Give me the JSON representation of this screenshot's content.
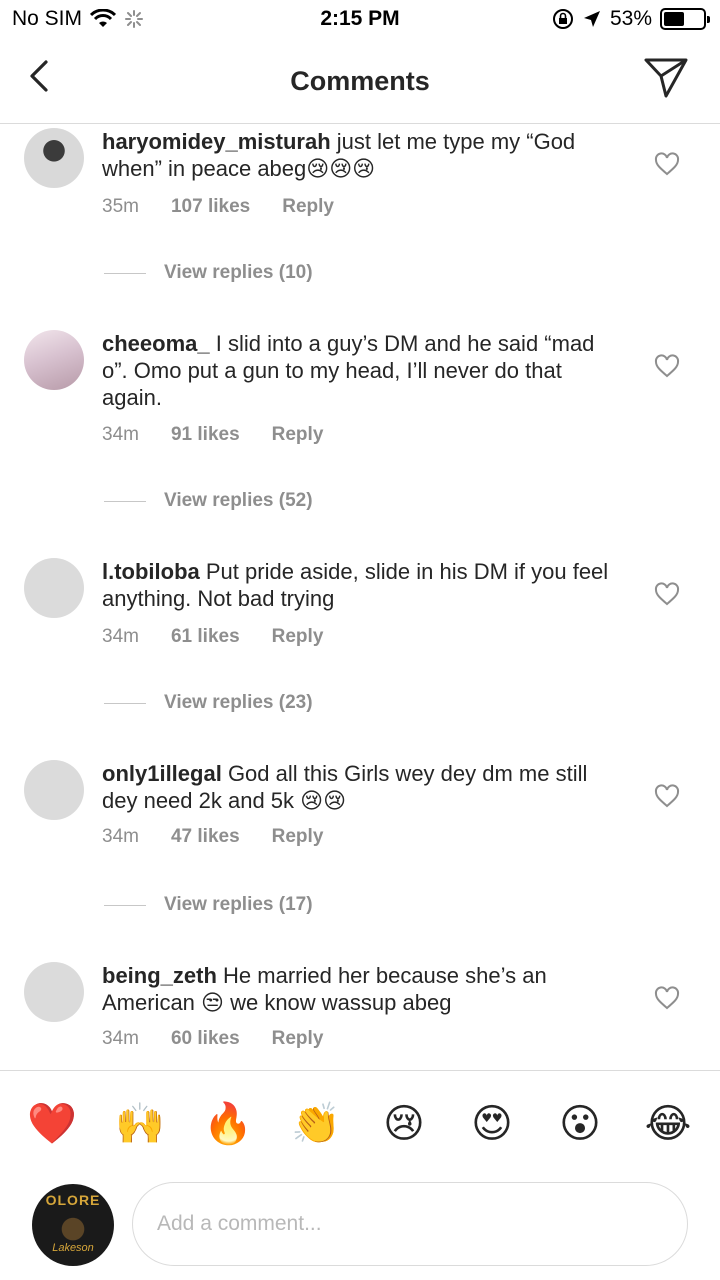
{
  "status_bar": {
    "carrier": "No SIM",
    "time": "2:15 PM",
    "battery_text": "53%",
    "battery_level": 0.53
  },
  "header": {
    "title": "Comments"
  },
  "comments": [
    {
      "username": "haryomidey_misturah",
      "text": " just let me type my “God when” in peace abeg😢😢😢",
      "time": "35m",
      "likes": "107 likes",
      "reply": "Reply",
      "view_replies": "View replies (10)"
    },
    {
      "username": "cheeoma_",
      "text": " I slid into a guy’s DM and he said “mad o”. Omo put a gun to my head, I’ll never do that again.",
      "time": "34m",
      "likes": "91 likes",
      "reply": "Reply",
      "view_replies": "View replies (52)"
    },
    {
      "username": "l.tobiloba",
      "text": " Put pride aside, slide in his DM if you feel anything. Not bad trying",
      "time": "34m",
      "likes": "61 likes",
      "reply": "Reply",
      "view_replies": "View replies (23)"
    },
    {
      "username": "only1illegal",
      "text": " God all this Girls wey dey dm me still dey need 2k and 5k 😢😢",
      "time": "34m",
      "likes": "47 likes",
      "reply": "Reply",
      "view_replies": "View replies (17)"
    },
    {
      "username": "being_zeth",
      "text": " He married her because she’s an American 😒 we know wassup abeg",
      "time": "34m",
      "likes": "60 likes",
      "reply": "Reply"
    }
  ],
  "emoji_bar": [
    "❤️",
    "🙌",
    "🔥",
    "👏",
    "😢",
    "😍",
    "😮",
    "😂"
  ],
  "composer": {
    "placeholder": "Add a comment...",
    "avatar_logo": "OLORE",
    "avatar_sub": "Lakeson"
  },
  "icons": {
    "back": "chevron-left-icon",
    "send": "paper-plane-icon",
    "like": "heart-outline-icon",
    "wifi": "wifi-icon",
    "activity": "loading-spinner-icon",
    "orientation_lock": "orientation-lock-icon",
    "location": "location-arrow-icon",
    "battery": "battery-icon"
  }
}
